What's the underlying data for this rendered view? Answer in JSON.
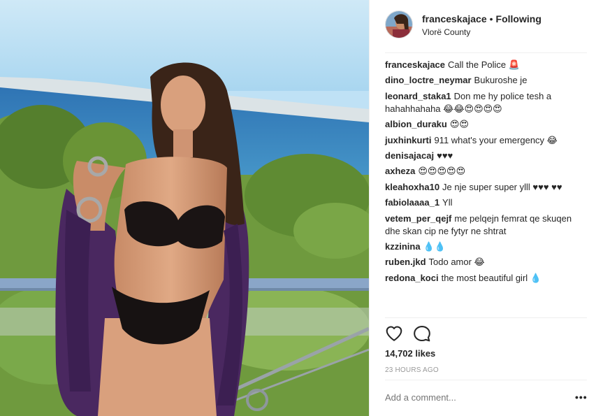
{
  "post": {
    "username": "franceskajace",
    "separator": "•",
    "follow_state": "Following",
    "location": "Vlorë County"
  },
  "comments": [
    {
      "user": "franceskajace",
      "text": "Call the Police 🚨"
    },
    {
      "user": "dino_loctre_neymar",
      "text": "Bukuroshe je"
    },
    {
      "user": "leonard_staka1",
      "text": "Don me hy police tesh a hahahhahaha 😂😂😍😍😍😍"
    },
    {
      "user": "albion_duraku",
      "text": "😍😍"
    },
    {
      "user": "juxhinkurti",
      "text": "911 what's your emergency 😂"
    },
    {
      "user": "denisajacaj",
      "text": "♥♥♥"
    },
    {
      "user": "axheza",
      "text": "😍😍😍😍😍"
    },
    {
      "user": "kleahoxha10",
      "text": "Je nje super super ylll ♥♥♥ ♥♥"
    },
    {
      "user": "fabiolaaaa_1",
      "text": "Yll"
    },
    {
      "user": "vetem_per_qejf",
      "text": "me pelqejn femrat qe skuqen dhe skan cip ne fytyr ne shtrat"
    },
    {
      "user": "kzzinina",
      "text": "💧💧"
    },
    {
      "user": "ruben.jkd",
      "text": "Todo amor 😂"
    },
    {
      "user": "redona_koci",
      "text": "the most beautiful girl 💧"
    }
  ],
  "actions": {
    "like_icon": "heart-outline-icon",
    "comment_icon": "speech-bubble-icon"
  },
  "likes": "14,702 likes",
  "timestamp": "23 HOURS AGO",
  "comment_input": {
    "placeholder": "Add a comment..."
  },
  "more_options": "•••"
}
